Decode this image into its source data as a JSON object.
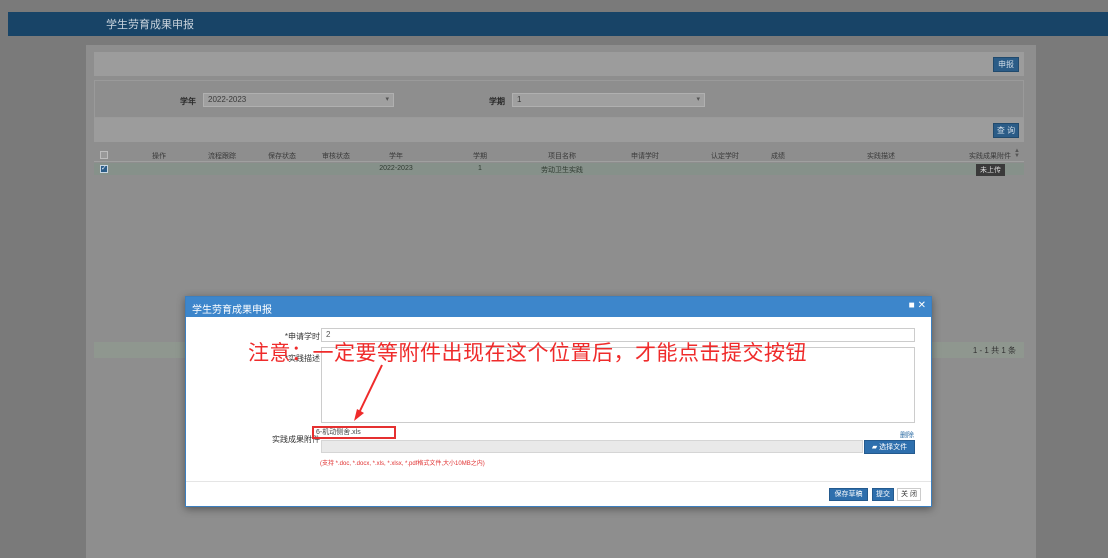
{
  "header": {
    "title": "学生劳育成果申报"
  },
  "toolbar": {
    "report_label": "申报",
    "query_label": "查 询"
  },
  "filters": {
    "year_label": "学年",
    "year_value": "2022-2023",
    "term_label": "学期",
    "term_value": "1"
  },
  "table": {
    "columns": [
      "操作",
      "流程跟踪",
      "保存状态",
      "审核状态",
      "学年",
      "学期",
      "项目名称",
      "申请学时",
      "认定学时",
      "成绩",
      "实践描述",
      "实践成果附件"
    ],
    "rows": [
      {
        "year": "2022-2023",
        "term": "1",
        "project": "劳动卫生实践",
        "attachment": "未上传"
      }
    ],
    "pager": "1 - 1  共 1 条"
  },
  "modal": {
    "title": "学生劳育成果申报",
    "hours_label": "*申请学时",
    "hours_value": "2",
    "desc_label": "*实践描述",
    "annotation": "注意：一定要等附件出现在这个位置后，才能点击提交按钮",
    "attachment_label": "实践成果附件",
    "attachment_file": "6-机动侧舍.xls",
    "delete_label": "删除",
    "choose_label": "选择文件",
    "hint": "(支持 *.doc, *.docx, *.xls, *.xlsx, *.pdf格式文件,大小10MB之内)",
    "save_draft_label": "保存草稿",
    "submit_label": "提交",
    "close_label": "关 闭"
  },
  "colors": {
    "header_bar": "#184467",
    "modal_header": "#3d86cb",
    "annotation": "#ef2b2b",
    "primary_button": "#2e6fad"
  }
}
